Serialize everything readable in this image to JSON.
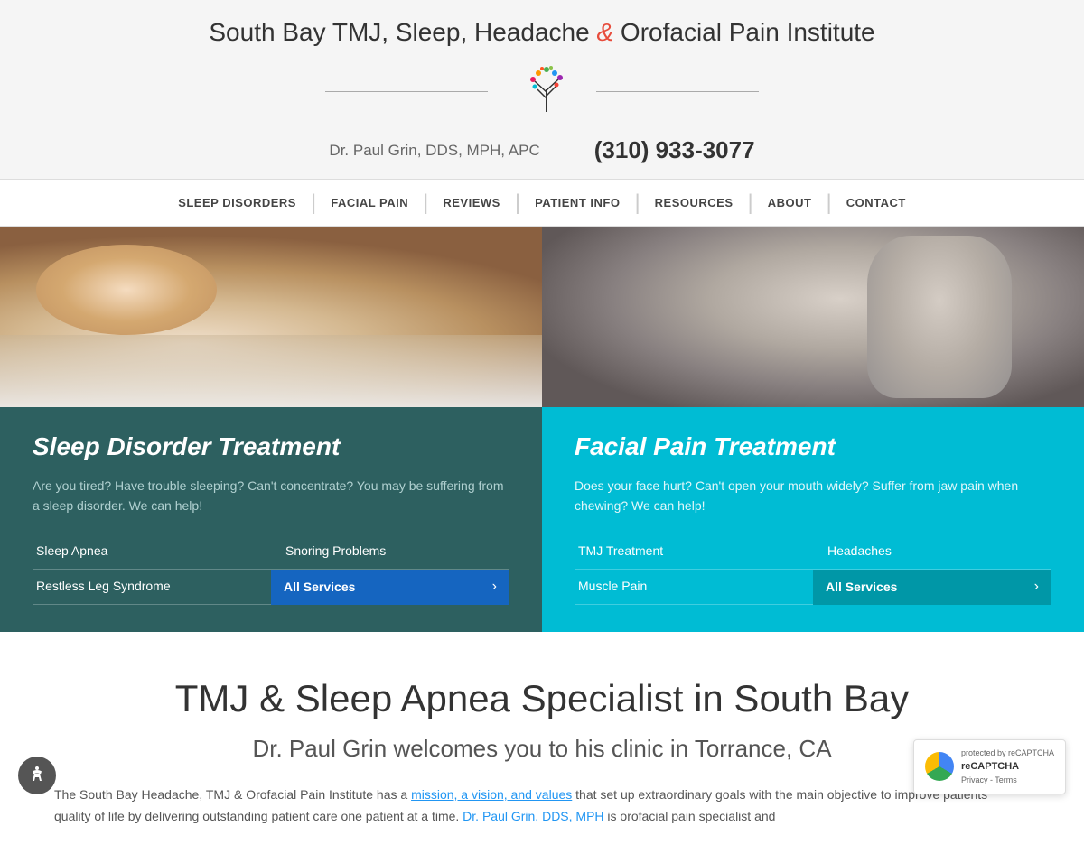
{
  "header": {
    "title_part1": "South Bay TMJ, Sleep, Headache",
    "ampersand": "&",
    "title_part2": "Orofacial Pain Institute",
    "doctor": "Dr. Paul Grin, DDS, MPH, APC",
    "phone": "(310) 933-3077"
  },
  "nav": {
    "items": [
      {
        "label": "SLEEP DISORDERS",
        "has_dropdown": true
      },
      {
        "label": "FACIAL PAIN",
        "has_dropdown": true
      },
      {
        "label": "REVIEWS",
        "has_dropdown": false
      },
      {
        "label": "PATIENT INFO",
        "has_dropdown": false
      },
      {
        "label": "RESOURCES",
        "has_dropdown": true
      },
      {
        "label": "ABOUT",
        "has_dropdown": true
      },
      {
        "label": "CONTACT",
        "has_dropdown": false
      }
    ]
  },
  "sleep_panel": {
    "heading": "Sleep Disorder Treatment",
    "description": "Are you tired? Have trouble sleeping? Can't concentrate? You may be suffering from a sleep disorder. We can help!",
    "links": [
      {
        "label": "Sleep Apnea",
        "highlight": false
      },
      {
        "label": "Snoring Problems",
        "highlight": false
      },
      {
        "label": "Restless Leg Syndrome",
        "highlight": false
      },
      {
        "label": "All Services",
        "highlight": true
      }
    ],
    "all_services_label": "All Services"
  },
  "pain_panel": {
    "heading": "Facial Pain Treatment",
    "description": "Does your face hurt? Can't open your mouth widely? Suffer from jaw pain when chewing? We can help!",
    "links": [
      {
        "label": "TMJ Treatment",
        "highlight": false
      },
      {
        "label": "Headaches",
        "highlight": false
      },
      {
        "label": "Muscle Pain",
        "highlight": false
      },
      {
        "label": "All Services",
        "highlight": true
      }
    ],
    "all_services_label": "All Services"
  },
  "main": {
    "title": "TMJ & Sleep Apnea Specialist in South Bay",
    "subtitle": "Dr. Paul Grin welcomes you to his clinic in Torrance, CA",
    "text_part1": "The South Bay Headache, TMJ & Orofacial Pain Institute has a ",
    "link_text": "mission, a vision, and values",
    "text_part2": " that set up extraordinary goals with the main objective to improve patients' quality of life by delivering outstanding patient care one patient at a time.",
    "text_part3": " ",
    "link2_text": "Dr. Paul Grin, DDS, MPH",
    "text_part4": " is orofacial pain specialist and"
  },
  "accessibility": {
    "label": "Accessibility"
  },
  "recaptcha": {
    "line1": "protected by reCAPTCHA",
    "brand": "reCAPTCHA",
    "line2": "Privacy - Terms"
  }
}
